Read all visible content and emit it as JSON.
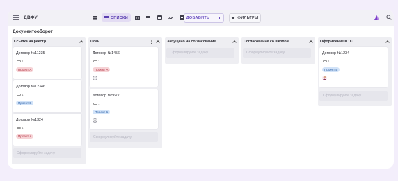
{
  "header": {
    "brand": "ДВФУ",
    "views": [
      {
        "icon": "kanban-icon",
        "active": false
      },
      {
        "icon": "list-icon",
        "label": "СПИСКИ",
        "active": true
      },
      {
        "icon": "table-icon",
        "active": false
      },
      {
        "icon": "sort-icon",
        "active": false
      },
      {
        "icon": "calendar-icon",
        "active": false
      },
      {
        "icon": "chart-icon",
        "active": false
      },
      {
        "icon": "archive-icon",
        "active": false
      }
    ],
    "add_label": "ДОБАВИТЬ",
    "filters_label": "ФИЛЬТРЫ"
  },
  "page_title": "Документооборот",
  "placeholder": "Сформулируйте задачу",
  "colors": {
    "accent": "#6a4fc0",
    "tag_a": "#f6d3d6",
    "tag_b": "#d2e3f8",
    "background": "#f3eefb"
  },
  "columns": [
    {
      "title": "Ссылка на реестр",
      "cards": [
        {
          "name": "Договор №11235",
          "comments": "1",
          "tag": "Проект А"
        },
        {
          "name": "Договор №12346",
          "comments": "1",
          "tag": "Проект Б"
        },
        {
          "name": "Договор №1324",
          "comments": "1",
          "tag": "Проект А"
        }
      ]
    },
    {
      "title": "План",
      "cards": [
        {
          "name": "Договор №1456",
          "comments": "1",
          "tag": "Проект А",
          "avatar": "А"
        },
        {
          "name": "Договор №5677",
          "comments": "1",
          "tag": "Проект Б",
          "avatar": "А"
        }
      ]
    },
    {
      "title": "Запущено на согласование",
      "cards": []
    },
    {
      "title": "Согласование со школой",
      "cards": []
    },
    {
      "title": "Оформление в 1С",
      "cards": [
        {
          "name": "Договор №1234",
          "comments": "1",
          "tag": "Проект Б"
        }
      ]
    }
  ]
}
